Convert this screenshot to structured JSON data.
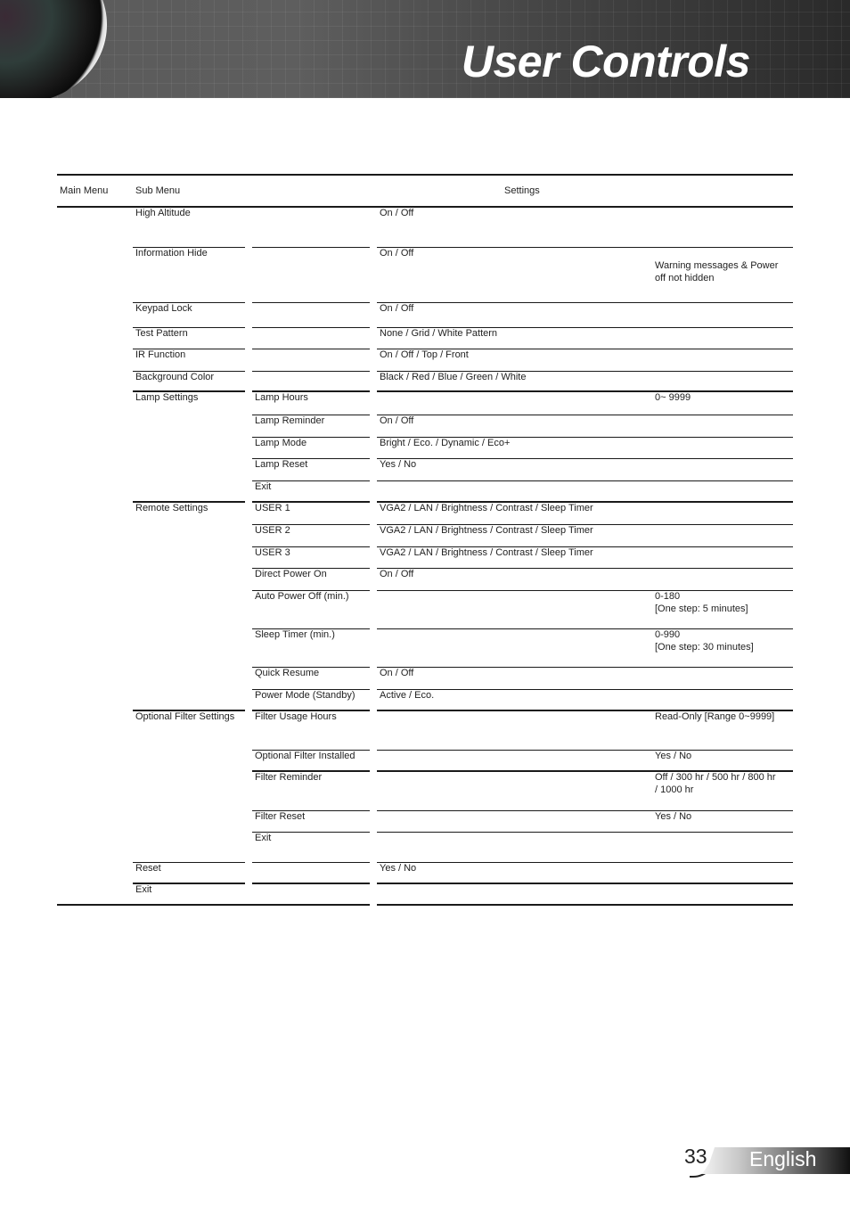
{
  "header": {
    "title": "User Controls"
  },
  "table": {
    "columns": {
      "main_menu": "Main Menu",
      "sub_menu": "Sub Menu",
      "settings": "Settings"
    },
    "rows": [
      {
        "main": "",
        "sub": "High Altitude",
        "sub2": "",
        "setting": "On / Off",
        "note": ""
      },
      {
        "main": "",
        "sub": "Information Hide",
        "sub2": "",
        "setting": "On / Off",
        "note": "Warning messages & Power off not hidden"
      },
      {
        "main": "",
        "sub": "Keypad Lock",
        "sub2": "",
        "setting": "On / Off",
        "note": ""
      },
      {
        "main": "",
        "sub": "Test Pattern",
        "sub2": "",
        "setting": "None / Grid / White Pattern",
        "note": ""
      },
      {
        "main": "",
        "sub": "IR Function",
        "sub2": "",
        "setting": "On / Off / Top / Front",
        "note": ""
      },
      {
        "main": "",
        "sub": "Background Color",
        "sub2": "",
        "setting": "Black / Red / Blue / Green / White",
        "note": ""
      },
      {
        "main": "",
        "sub": "Lamp Settings",
        "sub2": "Lamp Hours",
        "setting": "",
        "note": "0~ 9999"
      },
      {
        "main": "",
        "sub": "",
        "sub2": "Lamp Reminder",
        "setting": "On / Off",
        "note": ""
      },
      {
        "main": "",
        "sub": "",
        "sub2": "Lamp Mode",
        "setting": "Bright / Eco. / Dynamic / Eco+",
        "note": ""
      },
      {
        "main": "",
        "sub": "",
        "sub2": "Lamp Reset",
        "setting": "Yes / No",
        "note": ""
      },
      {
        "main": "",
        "sub": "",
        "sub2": "Exit",
        "setting": "",
        "note": ""
      },
      {
        "main": "",
        "sub": "Remote Settings",
        "sub2": "USER 1",
        "setting": "VGA2 / LAN / Brightness / Contrast / Sleep Timer",
        "note": ""
      },
      {
        "main": "",
        "sub": "",
        "sub2": "USER 2",
        "setting": "VGA2 / LAN / Brightness / Contrast / Sleep Timer",
        "note": ""
      },
      {
        "main": "",
        "sub": "",
        "sub2": "USER 3",
        "setting": "VGA2 / LAN / Brightness / Contrast / Sleep Timer",
        "note": ""
      },
      {
        "main": "",
        "sub": "",
        "sub2": "Direct Power On",
        "setting": "On / Off",
        "note": ""
      },
      {
        "main": "",
        "sub": "",
        "sub2": "Auto Power Off (min.)",
        "setting": "",
        "note": "0-180",
        "note2": "[One step: 5 minutes]"
      },
      {
        "main": "",
        "sub": "",
        "sub2": "Sleep Timer (min.)",
        "setting": "",
        "note": "0-990",
        "note2": "[One step: 30 minutes]"
      },
      {
        "main": "",
        "sub": "",
        "sub2": "Quick Resume",
        "setting": "On / Off",
        "note": ""
      },
      {
        "main": "",
        "sub": "",
        "sub2": "Power Mode (Standby)",
        "setting": "Active / Eco.",
        "note": ""
      },
      {
        "main": "",
        "sub": "Optional Filter Settings",
        "sub2": "Filter Usage Hours",
        "setting": "",
        "note": "Read-Only [Range 0~9999]"
      },
      {
        "main": "",
        "sub": "",
        "sub2": "Optional Filter Installed",
        "setting": "",
        "note": "Yes / No"
      },
      {
        "main": "",
        "sub": "",
        "sub2": "Filter Reminder",
        "setting": "",
        "note": "Off / 300 hr / 500 hr / 800 hr",
        "note2": "/ 1000 hr"
      },
      {
        "main": "",
        "sub": "",
        "sub2": "Filter Reset",
        "setting": "",
        "note": "Yes / No"
      },
      {
        "main": "",
        "sub": "",
        "sub2": "Exit",
        "setting": "",
        "note": ""
      },
      {
        "main": "",
        "sub": "Reset",
        "sub2": "",
        "setting": "Yes / No",
        "note": ""
      },
      {
        "main": "",
        "sub": "Exit",
        "sub2": "",
        "setting": "",
        "note": ""
      }
    ]
  },
  "footer": {
    "page_number": "33",
    "language": "English"
  }
}
